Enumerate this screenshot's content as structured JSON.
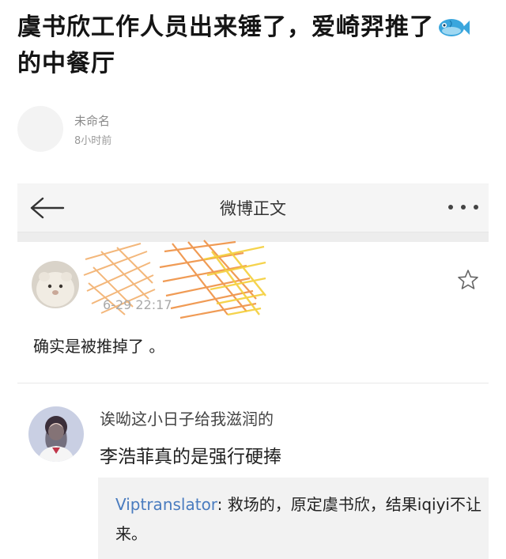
{
  "post": {
    "title_part1": "虞书欣工作人员出来锤了，爱崎羿推了",
    "title_part2": "的中餐厅",
    "fish_icon": "fish-icon",
    "author_name": "未命名",
    "time": "8小时前"
  },
  "screenshot": {
    "nav": {
      "back_icon": "arrow-left-icon",
      "title": "微博正文",
      "more_icon": "more-dots-icon"
    },
    "weibo": {
      "time": "6-29 22:17",
      "text": "确实是被推掉了 。",
      "star_icon": "star-outline-icon"
    },
    "comment": {
      "user": "诶呦这小日子给我滋润的",
      "text": "李浩菲真的是强行硬捧",
      "reply_user": "Viptranslator",
      "reply_text": ": 救场的，原定虞书欣，结果iqiyi不让来。"
    }
  },
  "colors": {
    "reply_user": "#4a7cbf",
    "scribble_orange": "#f0a050",
    "scribble_yellow": "#f4cf3a"
  }
}
